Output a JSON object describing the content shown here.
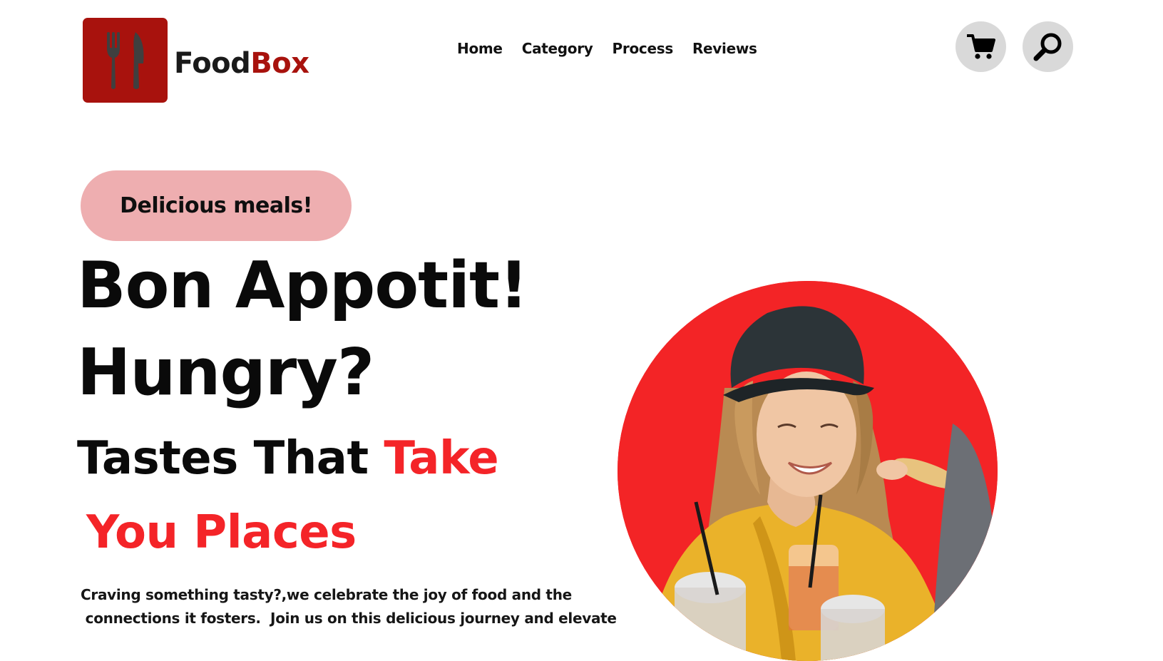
{
  "brand": {
    "name_part1": "Food",
    "name_part2": "Box",
    "logo_icon": "fork-knife-icon",
    "colors": {
      "primary": "#a8120d",
      "accent": "#f42428"
    }
  },
  "nav": {
    "items": [
      {
        "label": "Home"
      },
      {
        "label": "Category"
      },
      {
        "label": "Process"
      },
      {
        "label": "Reviews"
      }
    ]
  },
  "header_actions": {
    "cart_icon": "cart-icon",
    "search_icon": "search-icon"
  },
  "hero": {
    "badge": "Delicious meals!",
    "line1": "Bon Appotit!",
    "line2": "Hungry?",
    "line3_a": "Tastes That ",
    "line3_b": "Take",
    "line4": "You Places",
    "description_line1": "Craving something tasty?,we celebrate the joy of food and the",
    "description_line2": " connections it fosters.  Join us on this delicious journey and elevate",
    "image": "smiling-woman-eating-pizza-photo"
  }
}
